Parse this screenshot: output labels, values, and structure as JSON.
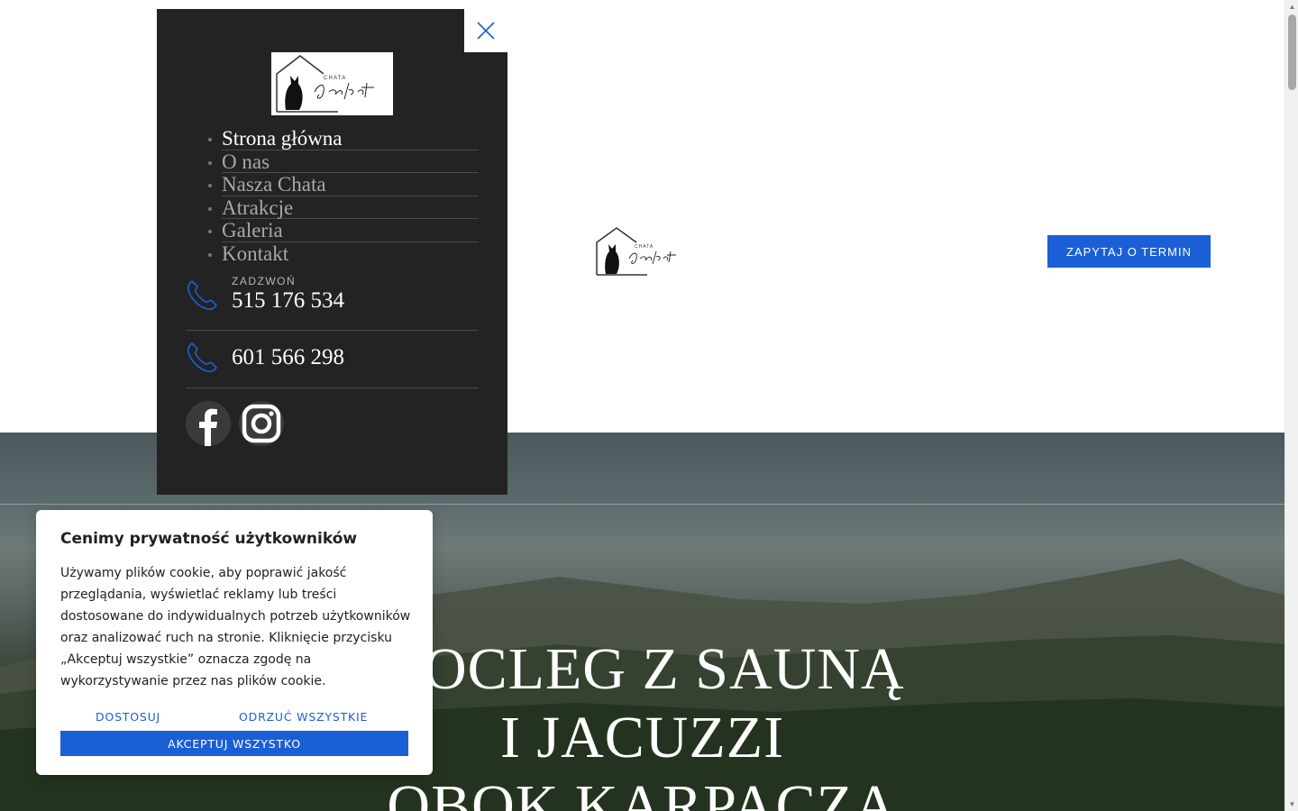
{
  "header": {
    "logo_alt": "Chata Czarny Kot",
    "cta_label": "ZAPYTAJ O TERMIN"
  },
  "menu": {
    "items": [
      {
        "label": "Strona główna",
        "active": true
      },
      {
        "label": "O nas",
        "active": false
      },
      {
        "label": "Nasza Chata",
        "active": false
      },
      {
        "label": "Atrakcje",
        "active": false
      },
      {
        "label": "Galeria",
        "active": false
      },
      {
        "label": "Kontakt",
        "active": false
      }
    ],
    "call_label": "ZADZWOŃ",
    "phone_1": "515 176 534",
    "phone_2": "601 566 298"
  },
  "hero": {
    "title_lines": [
      "NOCLEG Z SAUNĄ",
      "I JACUZZI",
      "OBOK KARPACZA"
    ]
  },
  "cookie": {
    "title": "Cenimy prywatność użytkowników",
    "text": "Używamy plików cookie, aby poprawić jakość przeglądania, wyświetlać reklamy lub treści dostosowane do indywidualnych potrzeb użytkowników oraz analizować ruch na stronie. Kliknięcie przycisku „Akceptuj wszystkie” oznacza zgodę na wykorzystywanie przez nas plików cookie.",
    "customize_label": "DOSTOSUJ",
    "reject_label": "ODRZUĆ WSZYSTKIE",
    "accept_label": "AKCEPTUJ WSZYSTKO"
  },
  "colors": {
    "accent": "#1b5fd6",
    "menu_bg": "#232323"
  }
}
